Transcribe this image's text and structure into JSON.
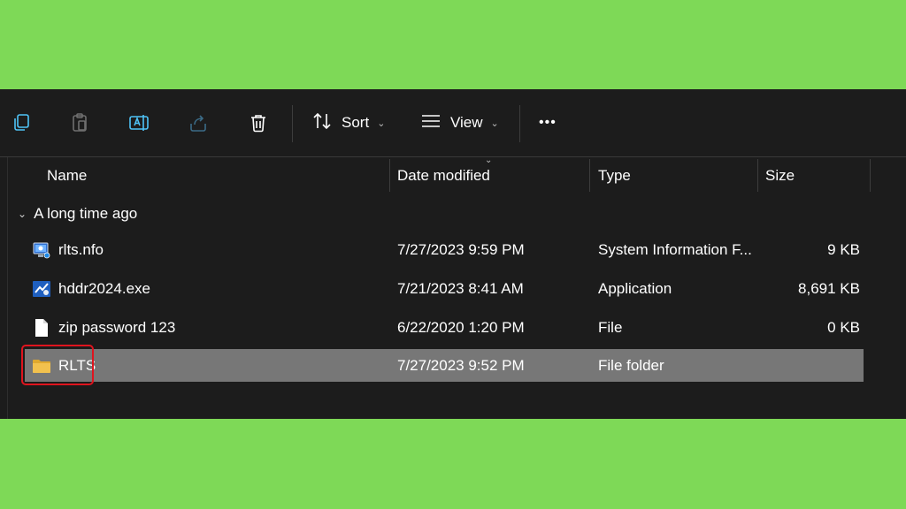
{
  "toolbar": {
    "sort_label": "Sort",
    "view_label": "View",
    "more_label": "•••"
  },
  "columns": {
    "name": "Name",
    "date_modified": "Date modified",
    "type": "Type",
    "size": "Size"
  },
  "group": {
    "label": "A long time ago"
  },
  "files": [
    {
      "name": "rlts.nfo",
      "date": "7/27/2023 9:59 PM",
      "type": "System Information F...",
      "size": "9 KB",
      "icon": "system-info-icon"
    },
    {
      "name": "hddr2024.exe",
      "date": "7/21/2023 8:41 AM",
      "type": "Application",
      "size": "8,691 KB",
      "icon": "application-icon"
    },
    {
      "name": "zip password 123",
      "date": "6/22/2020 1:20 PM",
      "type": "File",
      "size": "0 KB",
      "icon": "file-icon"
    },
    {
      "name": "RLTS",
      "date": "7/27/2023 9:52 PM",
      "type": "File folder",
      "size": "",
      "icon": "folder-icon",
      "selected": true
    }
  ],
  "colors": {
    "background": "#7ed957",
    "window": "#1c1c1c",
    "selection": "#777777",
    "highlight_border": "#e0141e",
    "folder": "#f2c14e"
  }
}
